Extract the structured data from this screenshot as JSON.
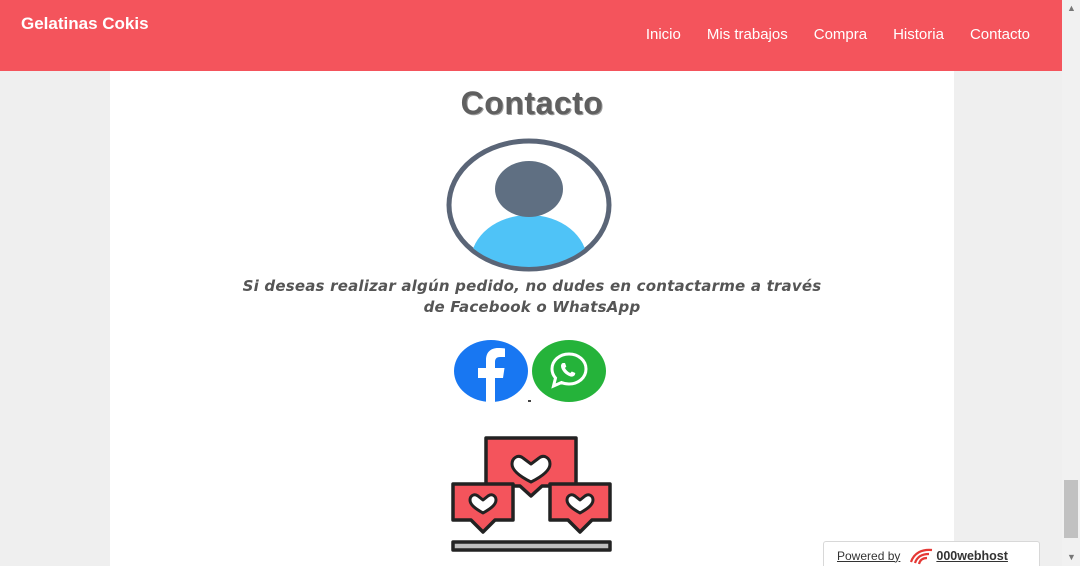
{
  "header": {
    "brand": "Gelatinas Cokis",
    "nav": [
      {
        "label": "Inicio"
      },
      {
        "label": "Mis trabajos"
      },
      {
        "label": "Compra"
      },
      {
        "label": "Historia"
      },
      {
        "label": "Contacto"
      }
    ]
  },
  "main": {
    "title": "Contacto",
    "message": "Si deseas realizar algún pedido, no dudes en contactarme a través de Facebook o WhatsApp",
    "social": [
      {
        "icon": "facebook-icon"
      },
      {
        "icon": "whatsapp-icon"
      }
    ]
  },
  "footer_badge": {
    "powered_by": "Powered by",
    "host": "000webhost"
  },
  "colors": {
    "nav_bg": "#f4545c",
    "facebook": "#1877f2",
    "whatsapp": "#25b33a",
    "avatar_ring": "#5a6577",
    "avatar_body": "#4fc3f7"
  }
}
